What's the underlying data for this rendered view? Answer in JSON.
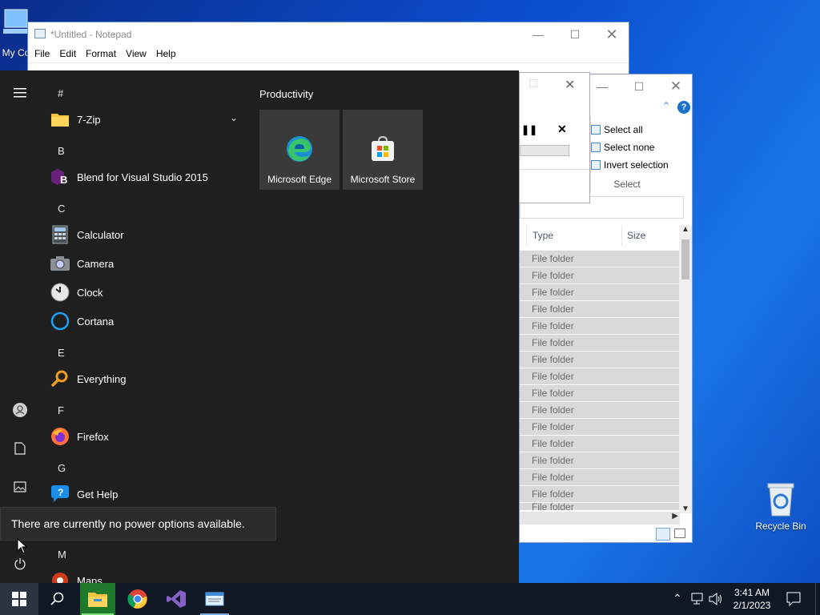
{
  "desktop": {
    "my_computer_label": "My Co",
    "recycle_bin_label": "Recycle Bin"
  },
  "notepad": {
    "title": "*Untitled - Notepad",
    "menu": [
      "File",
      "Edit",
      "Format",
      "View",
      "Help"
    ]
  },
  "explorer": {
    "ribbon": {
      "select_all": "Select all",
      "select_none": "Select none",
      "invert_selection": "Invert selection",
      "group_label": "Select"
    },
    "columns": {
      "type": "Type",
      "size": "Size"
    },
    "rows": [
      "File folder",
      "File folder",
      "File folder",
      "File folder",
      "File folder",
      "File folder",
      "File folder",
      "File folder",
      "File folder",
      "File folder",
      "File folder",
      "File folder",
      "File folder",
      "File folder",
      "File folder",
      "File folder"
    ]
  },
  "start_menu": {
    "tiles_header": "Productivity",
    "tiles": [
      {
        "label": "Microsoft Edge",
        "icon": "edge-icon"
      },
      {
        "label": "Microsoft Store",
        "icon": "store-icon"
      }
    ],
    "groups": [
      {
        "letter": "#",
        "apps": [
          {
            "label": "7-Zip",
            "icon": "folder-icon"
          }
        ]
      },
      {
        "letter": "B",
        "apps": [
          {
            "label": "Blend for Visual Studio 2015",
            "icon": "blend-icon"
          }
        ]
      },
      {
        "letter": "C",
        "apps": [
          {
            "label": "Calculator",
            "icon": "calculator-icon"
          },
          {
            "label": "Camera",
            "icon": "camera-icon"
          },
          {
            "label": "Clock",
            "icon": "clock-icon"
          },
          {
            "label": "Cortana",
            "icon": "cortana-icon"
          }
        ]
      },
      {
        "letter": "E",
        "apps": [
          {
            "label": "Everything",
            "icon": "everything-icon"
          }
        ]
      },
      {
        "letter": "F",
        "apps": [
          {
            "label": "Firefox",
            "icon": "firefox-icon"
          }
        ]
      },
      {
        "letter": "G",
        "apps": [
          {
            "label": "Get Help",
            "icon": "get-help-icon"
          }
        ]
      },
      {
        "letter": "M",
        "apps": [
          {
            "label": "Maps",
            "icon": "maps-icon"
          }
        ]
      }
    ],
    "power_tooltip": "There are currently no power options available."
  },
  "taskbar": {
    "time": "3:41 AM",
    "date": "2/1/2023"
  }
}
